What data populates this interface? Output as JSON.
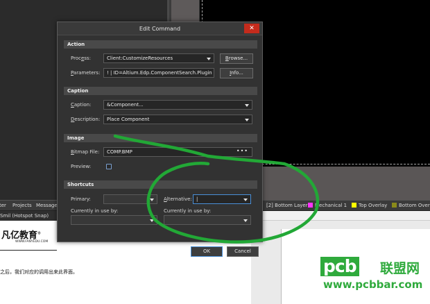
{
  "dialog": {
    "title": "Edit Command",
    "close_glyph": "✕",
    "action": {
      "header": "Action",
      "process_label": "Process:",
      "process_value": "Client:CustomizeResources",
      "browse_label": "Browse...",
      "parameters_label": "Parameters:",
      "parameters_value": "! | ID=Altium.Edp.ComponentSearch.Plugin",
      "info_label": "Info..."
    },
    "caption": {
      "header": "Caption",
      "caption_label": "Caption:",
      "caption_value": "&Component...",
      "description_label": "Description:",
      "description_value": "Place Component"
    },
    "image": {
      "header": "Image",
      "bitmap_label": "Bitmap File:",
      "bitmap_value": "COMP.BMP",
      "bitmap_more": "•••",
      "preview_label": "Preview:"
    },
    "shortcuts": {
      "header": "Shortcuts",
      "primary_label": "Primary:",
      "primary_value": "",
      "alternative_label": "Alternative:",
      "alternative_value": "|",
      "in_use_label_1": "Currently in use by:",
      "in_use_value_1": "",
      "in_use_label_2": "Currently in use by:",
      "in_use_value_2": ""
    },
    "ok_label": "OK",
    "cancel_label": "Cancel"
  },
  "background": {
    "tabs_left": [
      "ter",
      "Projects",
      "Message"
    ],
    "layer_tabs": [
      {
        "label": "[2] Bottom Layer",
        "color": "#1a3cff"
      },
      {
        "label": "Mechanical 1",
        "color": "#ff33ff"
      },
      {
        "label": "Top Overlay",
        "color": "#ffff00"
      },
      {
        "label": "Bottom Overl",
        "color": "#8a8a1a"
      }
    ],
    "status": "Smil    (Hotspot Snap)",
    "doc_logo": "凡亿教育",
    "doc_logo_mark": "®",
    "doc_logo_url": "WWW.FANYEDU.COM",
    "doc_text": "之后，我们对应的调用出来此界面。"
  },
  "watermark": {
    "brand": "pcb",
    "brand_cn": "联盟网",
    "url": "www.pcbbar.com"
  },
  "colors": {
    "annotation_green": "#22a836",
    "accent_blue": "#4a90d9",
    "close_red": "#c42b1c"
  }
}
